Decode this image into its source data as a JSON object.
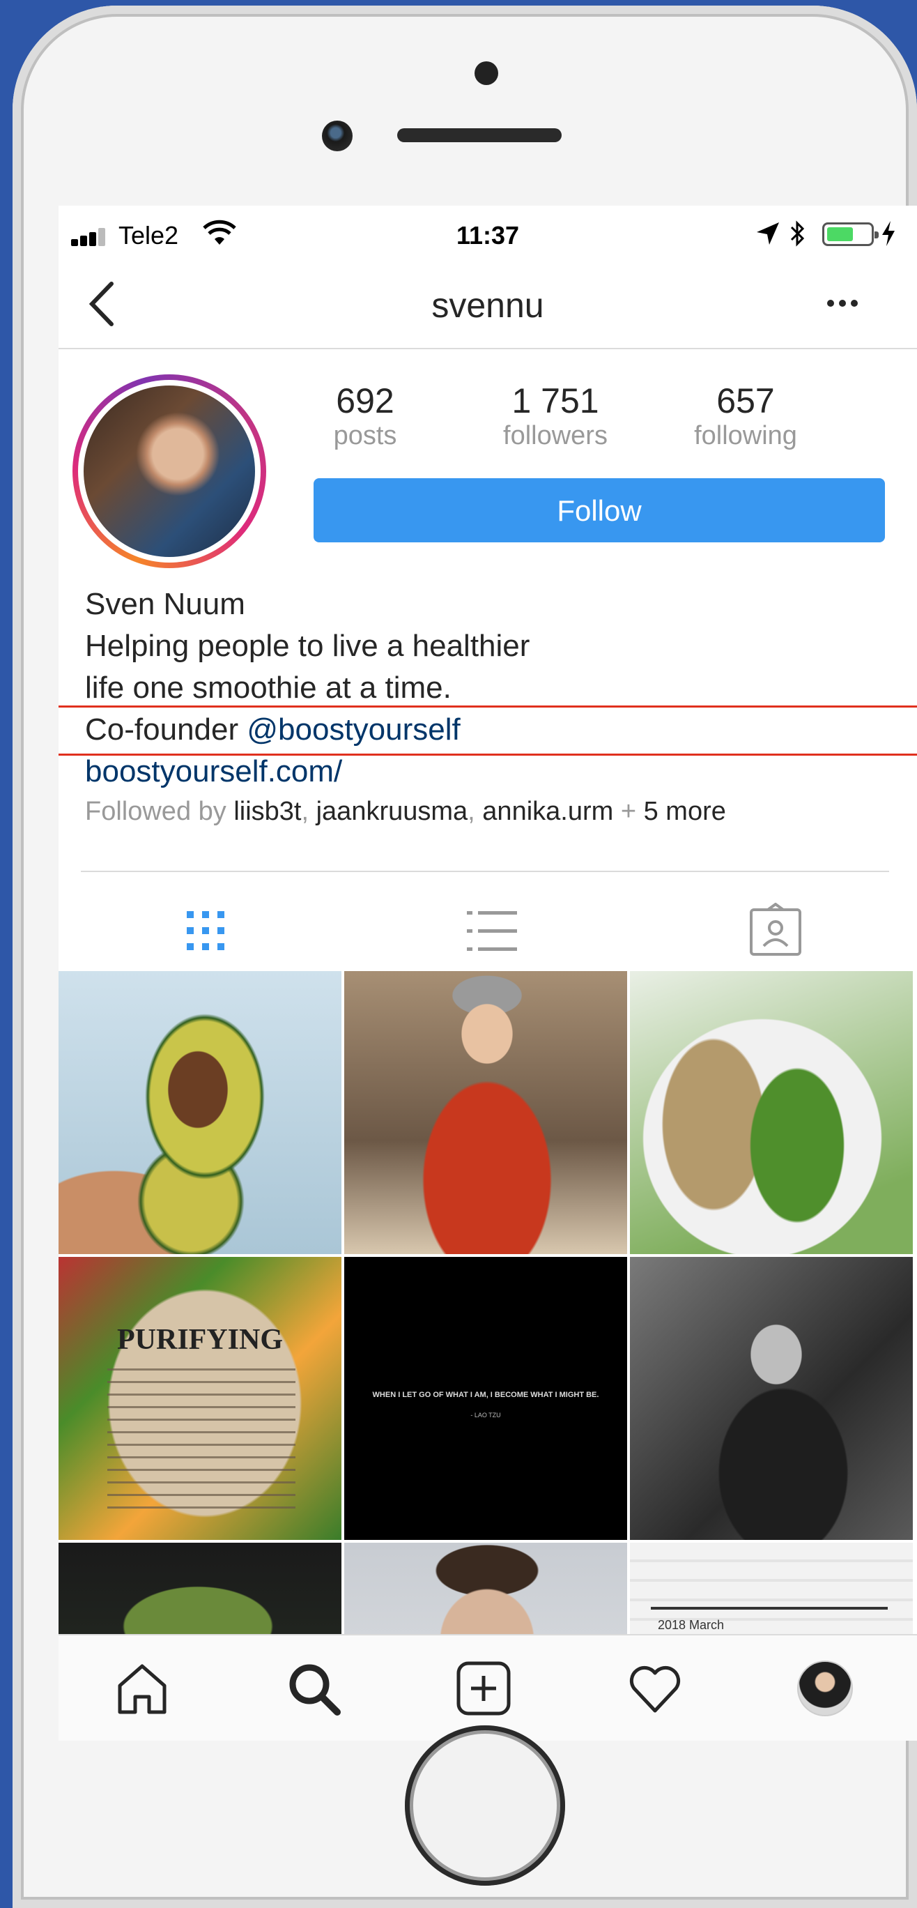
{
  "status_bar": {
    "carrier": "Tele2",
    "time": "11:37",
    "battery_level": 0.6
  },
  "header": {
    "username": "svennu"
  },
  "profile": {
    "stats": [
      {
        "value": "692",
        "label": "posts"
      },
      {
        "value": "1 751",
        "label": "followers"
      },
      {
        "value": "657",
        "label": "following"
      }
    ],
    "follow_label": "Follow",
    "name": "Sven Nuum",
    "bio_line1": "Helping people to live a healthier",
    "bio_line2": "life one smoothie at a time.",
    "bio_prefix": "Co-founder ",
    "bio_mention": "@boostyourself",
    "website": "boostyourself.com/",
    "followed_by_prefix": "Followed by ",
    "followed_by_users": [
      "liisb3t",
      "jaankruusma",
      "annika.urm"
    ],
    "followed_by_sep": ", ",
    "followed_by_more_plus": " + ",
    "followed_by_more": "5 more"
  },
  "tabs": {
    "icons": [
      "grid-icon",
      "list-icon",
      "tagged-icon"
    ],
    "active": "grid-icon",
    "active_color": "#3897f0"
  },
  "grid": {
    "book_title": "PURIFYING",
    "quote_text": "WHEN I LET GO OF WHAT I AM, I BECOME WHAT I MIGHT BE.",
    "quote_author": "- LAO TZU",
    "calendar_caption": "2018 March"
  },
  "bottom_nav": {
    "icons": [
      "home-icon",
      "search-icon",
      "new-post-icon",
      "activity-heart-icon",
      "profile-avatar"
    ],
    "active": "search-icon"
  },
  "colors": {
    "accent": "#3897f0",
    "link": "#003569",
    "highlight_box": "#e0301e",
    "device_background": "#2e57a8"
  }
}
